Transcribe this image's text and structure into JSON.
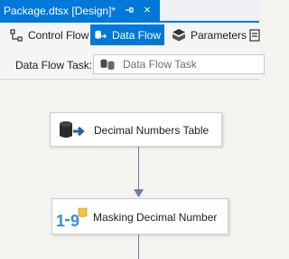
{
  "document_tab": {
    "title": "Package.dtsx [Design]*",
    "close_glyph": "×"
  },
  "designer_tabs": [
    {
      "label": "Control Flow",
      "icon": "control-flow-icon",
      "selected": false
    },
    {
      "label": "Data Flow",
      "icon": "data-flow-icon",
      "selected": true
    },
    {
      "label": "Parameters",
      "icon": "parameters-icon",
      "selected": false
    }
  ],
  "task_bar": {
    "label": "Data Flow Task:",
    "selected_task": "Data Flow Task"
  },
  "canvas": {
    "components": [
      {
        "label": "Decimal Numbers Table",
        "icon": "database-source-icon"
      },
      {
        "label": "Masking Decimal Number",
        "icon": "numeric-transform-icon"
      }
    ]
  },
  "colors": {
    "accent": "#0078d7",
    "connector": "#6b7ea8",
    "canvas_bg": "#f5f3ef"
  }
}
